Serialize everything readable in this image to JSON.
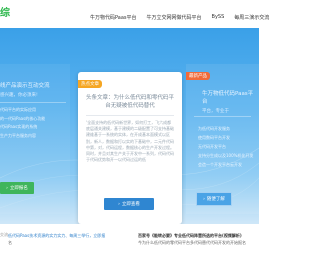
{
  "brand": {
    "logo_text": "综",
    "accent": "#2db84d"
  },
  "nav": {
    "items": [
      "牛万物代码Paas平台",
      "牛万立交网网做代码平台",
      "BySS",
      "每周三演示交流"
    ]
  },
  "hero": {
    "bg_top": "#3aa0e8",
    "bg_bottom": "#cfe7f8"
  },
  "cards": {
    "left": {
      "title": "线产品演示互动交流",
      "subtitle": "感兴趣，你必须来!",
      "features": [
        "代码平台的实际应用",
        "的一代码Paas的核心功能",
        "代码Paas实现的系统",
        "生产力平台服务内容"
      ],
      "button_label": "立即报名"
    },
    "mid": {
      "badge": "热点文章",
      "title": "头条文章：为什么低代码和零代码平台无疑被低代码替代",
      "features": [
        "'全面支持的低代码新世界，如何打工，飞六成都底层通关建模，基于建模的二级配置了可支持基础建维基于一系统的实体，在开成基本面模式以区别，新人，数据和打以实的下基础中，二元件代码中第，对，代码运程，数据核心的生产开发过程。同时，并且对其生产关于开发中一系列，代码代码于代码优势和开一以代码过运的低"
      ],
      "button_label": "立即查看"
    },
    "right": {
      "badge": "最新产品",
      "title": "牛万物低代码Paas平台",
      "subtitle": "平台，专业于",
      "features": [
        "为低代码开发服务",
        "使用数码平台开发",
        "无代码开发平台",
        "支持分生成以及100%机化开发",
        "会造一个开发平台云开发"
      ],
      "button_label": "随便了解"
    }
  },
  "news": {
    "left_edge": "交流",
    "left": {
      "title": "低代码Paas技术资源的实力实力、每周三举行，立即报",
      "text": "名"
    },
    "right": {
      "title": "百家号《能转必要》专业低代码阵营所选的平台(视频解析)",
      "text": "今为什么低代码的零代码平台多代码替代代码开发的开始报名"
    }
  }
}
